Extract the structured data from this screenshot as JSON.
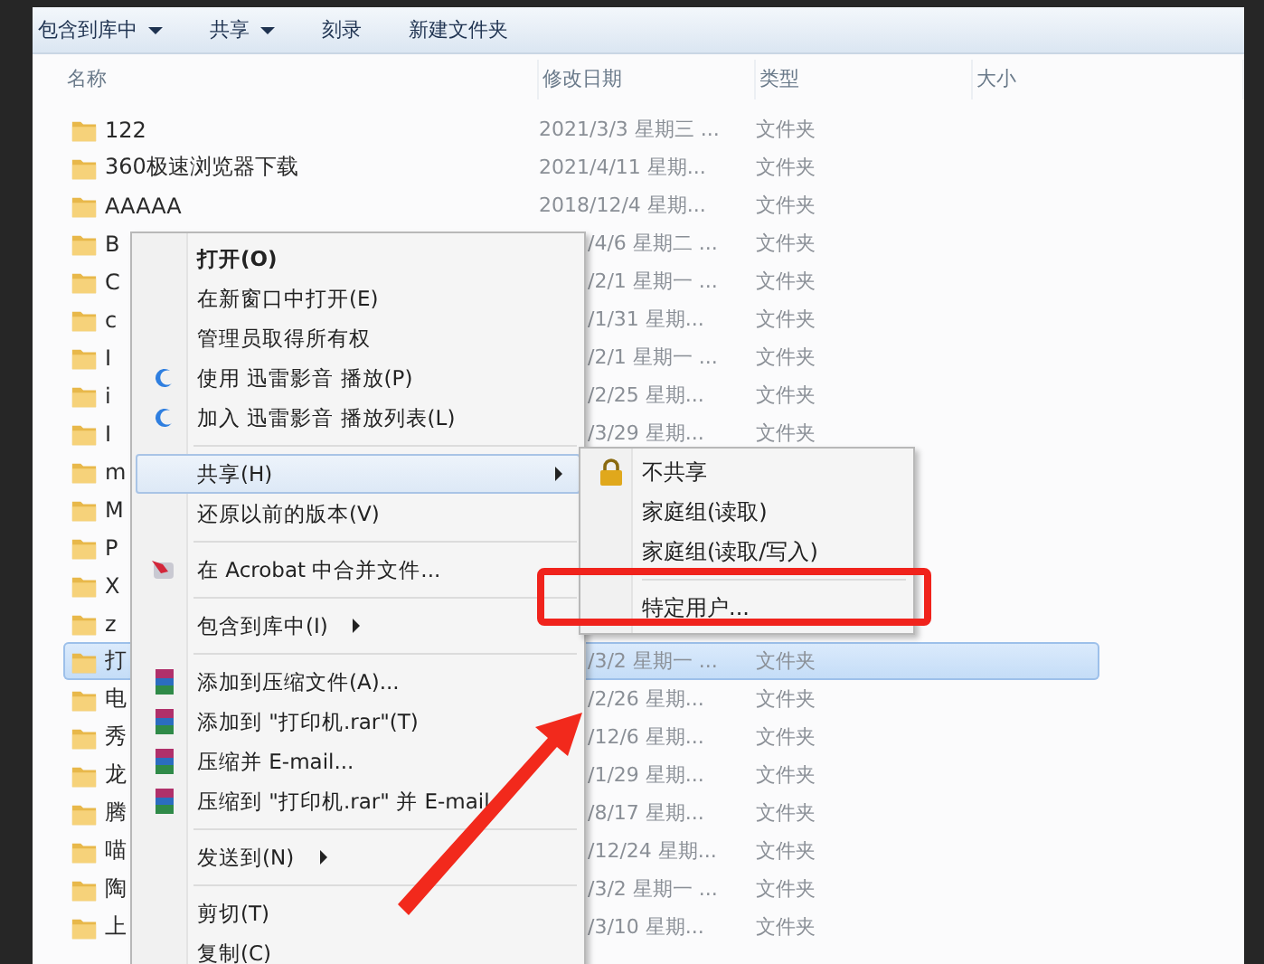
{
  "toolbar": [
    {
      "label": "包含到库中",
      "dropdown": true
    },
    {
      "label": "共享",
      "dropdown": true
    },
    {
      "label": "刻录",
      "dropdown": false
    },
    {
      "label": "新建文件夹",
      "dropdown": false
    }
  ],
  "columns": [
    "名称",
    "修改日期",
    "类型",
    "大小"
  ],
  "rows": [
    {
      "name": "122",
      "date": "2021/3/3 星期三 ...",
      "type": "文件夹",
      "selected": false
    },
    {
      "name": "360极速浏览器下载",
      "date": "2021/4/11 星期...",
      "type": "文件夹",
      "selected": false
    },
    {
      "name": "AAAAA",
      "date": "2018/12/4 星期...",
      "type": "文件夹",
      "selected": false
    },
    {
      "name": "B",
      "date_tail": "/4/6 星期二 ...",
      "type": "文件夹",
      "selected": false
    },
    {
      "name": "C",
      "date_tail": "/2/1 星期一 ...",
      "type": "文件夹",
      "selected": false
    },
    {
      "name": "c",
      "date_tail": "/1/31 星期...",
      "type": "文件夹",
      "selected": false
    },
    {
      "name": "I",
      "date_tail": "/2/1 星期一 ...",
      "type": "文件夹",
      "selected": false
    },
    {
      "name": "i",
      "date_tail": "/2/25 星期...",
      "type": "文件夹",
      "selected": false
    },
    {
      "name": "I",
      "date_tail": "/3/29 星期...",
      "type": "文件夹",
      "selected": false
    },
    {
      "name": "m",
      "selected": false
    },
    {
      "name": "M",
      "selected": false
    },
    {
      "name": "P",
      "selected": false
    },
    {
      "name": "X",
      "selected": false
    },
    {
      "name": "z",
      "selected": false
    },
    {
      "name": "打",
      "date_tail": "/3/2 星期一 ...",
      "type": "文件夹",
      "selected": true
    },
    {
      "name": "电",
      "date_tail": "/2/26 星期...",
      "type": "文件夹",
      "selected": false
    },
    {
      "name": "秀",
      "date_tail": "/12/6 星期...",
      "type": "文件夹",
      "selected": false
    },
    {
      "name": "龙",
      "date_tail": "/1/29 星期...",
      "type": "文件夹",
      "selected": false
    },
    {
      "name": "腾",
      "date_tail": "/8/17 星期...",
      "type": "文件夹",
      "selected": false
    },
    {
      "name": "喵",
      "date_tail": "/12/24 星期...",
      "type": "文件夹",
      "selected": false
    },
    {
      "name": "陶",
      "date_tail": "/3/2 星期一 ...",
      "type": "文件夹",
      "selected": false
    },
    {
      "name": "上",
      "date_tail": "/3/10 星期...",
      "type": "文件夹",
      "selected": false
    }
  ],
  "context_menu": [
    {
      "kind": "item",
      "label": "打开(O)",
      "bold": true
    },
    {
      "kind": "item",
      "label": "在新窗口中打开(E)"
    },
    {
      "kind": "item",
      "label": "管理员取得所有权"
    },
    {
      "kind": "player_item",
      "label": "使用 迅雷影音 播放(P)"
    },
    {
      "kind": "player_item",
      "label": "加入 迅雷影音 播放列表(L)"
    },
    {
      "kind": "separator"
    },
    {
      "kind": "item",
      "label": "共享(H)",
      "submenu": true,
      "highlighted": true
    },
    {
      "kind": "item",
      "label": "还原以前的版本(V)"
    },
    {
      "kind": "separator"
    },
    {
      "kind": "acrobat_item",
      "label": "在 Acrobat 中合并文件..."
    },
    {
      "kind": "separator"
    },
    {
      "kind": "item",
      "label": "包含到库中(I)",
      "submenu": true
    },
    {
      "kind": "separator"
    },
    {
      "kind": "archive_item",
      "label": "添加到压缩文件(A)..."
    },
    {
      "kind": "archive_item",
      "label": "添加到 \"打印机.rar\"(T)"
    },
    {
      "kind": "archive_item",
      "label": "压缩并 E-mail..."
    },
    {
      "kind": "archive_item",
      "label": "压缩到 \"打印机.rar\" 并 E-mail"
    },
    {
      "kind": "separator"
    },
    {
      "kind": "item",
      "label": "发送到(N)",
      "submenu": true
    },
    {
      "kind": "separator"
    },
    {
      "kind": "item",
      "label": "剪切(T)"
    },
    {
      "kind": "item",
      "label": "复制(C)"
    }
  ],
  "share_submenu": [
    {
      "kind": "lock_item",
      "label": "不共享"
    },
    {
      "kind": "item",
      "label": "家庭组(读取)"
    },
    {
      "kind": "item",
      "label": "家庭组(读取/写入)"
    },
    {
      "kind": "separator"
    },
    {
      "kind": "item",
      "label": "特定用户...",
      "marked": true
    }
  ]
}
